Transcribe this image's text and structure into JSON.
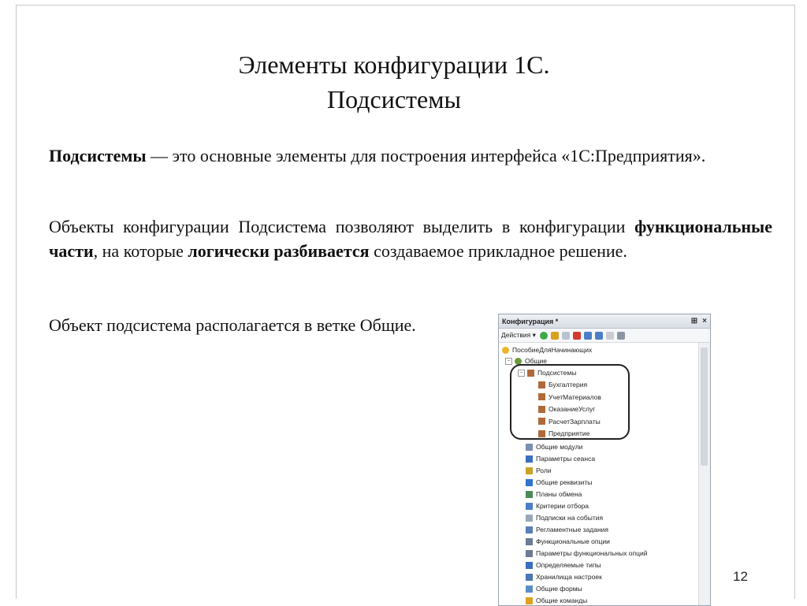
{
  "slide": {
    "title_line1": "Элементы конфигурации 1С.",
    "title_line2": "Подсистемы",
    "p1_bold": "Подсистемы",
    "p1_rest": " — это основные элементы для построения интерфейса «1С:Предприятия».",
    "p2_a": "Объекты конфигурации Подсистема позволяют выделить в конфигурации ",
    "p2_b_bold": "функциональные части",
    "p2_c": ", на которые ",
    "p2_d_bold": "логически разбивается",
    "p2_e": " создаваемое прикладное решение.",
    "p3": "Объект подсистема располагается в ветке Общие.",
    "page_number": "12"
  },
  "config_window": {
    "title": "Конфигурация *",
    "controls": [
      "⊞",
      "×"
    ],
    "toolbar": {
      "actions_label": "Действия ▾"
    },
    "tree": {
      "root": "ПособиеДляНачинающих",
      "general": "Общие",
      "subsystems": "Подсистемы",
      "subsystem_items": [
        "Бухгалтерия",
        "УчетМатериалов",
        "ОказаниеУслуг",
        "РасчетЗарплаты",
        "Предприятие"
      ],
      "other_items": [
        "Общие модули",
        "Параметры сеанса",
        "Роли",
        "Общие реквизиты",
        "Планы обмена",
        "Критерии отбора",
        "Подписки на события",
        "Регламентные задания",
        "Функциональные опции",
        "Параметры функциональных опций",
        "Определяемые типы",
        "Хранилища настроек",
        "Общие формы",
        "Общие команды"
      ]
    }
  }
}
